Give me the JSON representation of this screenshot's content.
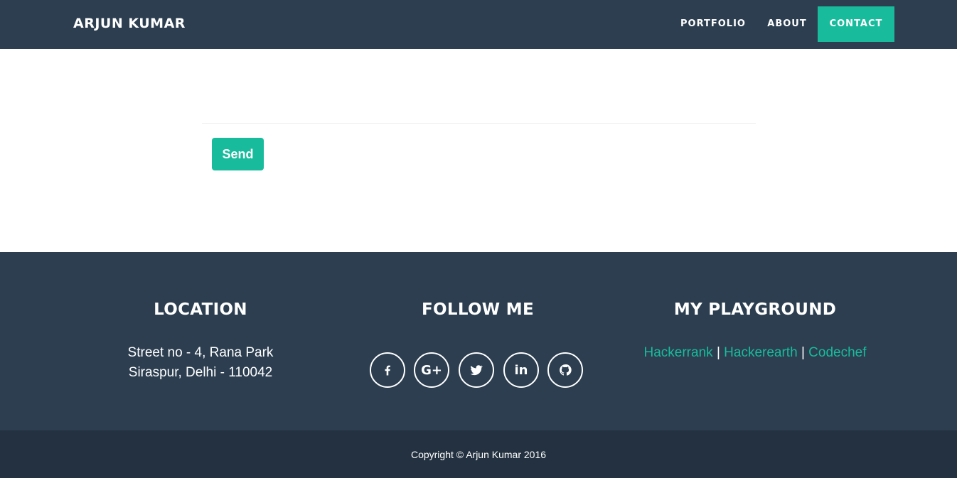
{
  "navbar": {
    "brand": "ARJUN KUMAR",
    "items": [
      {
        "label": "PORTFOLIO"
      },
      {
        "label": "ABOUT"
      },
      {
        "label": "CONTACT",
        "active": true
      }
    ]
  },
  "form": {
    "send_label": "Send"
  },
  "footer": {
    "location": {
      "heading": "LOCATION",
      "line1": "Street no - 4, Rana Park",
      "line2": "Siraspur, Delhi - 110042"
    },
    "follow": {
      "heading": "FOLLOW ME",
      "icons": [
        "facebook-icon",
        "google-plus-icon",
        "twitter-icon",
        "linkedin-icon",
        "github-icon"
      ],
      "google_plus_glyph": "G+",
      "linkedin_glyph": "in"
    },
    "playground": {
      "heading": "MY PLAYGROUND",
      "links": [
        "Hackerrank",
        "Hackerearth",
        "Codechef"
      ],
      "separator": "|"
    },
    "copyright": "Copyright © Arjun Kumar 2016"
  },
  "colors": {
    "primary": "#2c3e50",
    "accent": "#18bc9c",
    "footer_bottom": "#233140"
  }
}
